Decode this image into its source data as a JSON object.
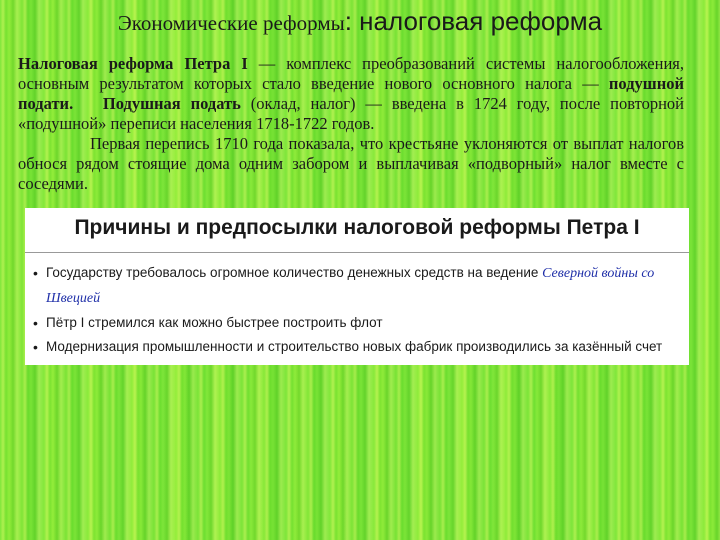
{
  "title": {
    "part1": "Экономические реформы",
    "part2": ": налоговая реформа"
  },
  "paragraph1": {
    "bold_start": "Налоговая реформа Петра I",
    "text1": " — комплекс преобразований системы налогообложения, основным результатом которых стало введение нового основного налога — ",
    "bold_mid": "подушной подати.",
    "gap": "   ",
    "bold_mid2": "Подушная подать",
    "text2": " (оклад, налог) — введена в 1724 году, после повторной «подушной» переписи населения 1718-1722 годов."
  },
  "paragraph2": "Первая перепись 1710 года показала, что крестьяне уклоняются от выплат налогов обнося рядом стоящие дома одним забором и выплачивая «подворный» налог вместе с соседями.",
  "card": {
    "title": "Причины и предпосылки налоговой реформы Петра I",
    "items": [
      {
        "text": "Государству требовалось огромное количество денежных средств на ведение ",
        "link": "Северной войны со Швецией"
      },
      {
        "text": "Пётр I стремился как можно быстрее построить флот"
      },
      {
        "text": "Модернизация промышленности и строительство новых фабрик производились за казённый счет"
      }
    ]
  },
  "colors": {
    "background": "#7ee63a",
    "link": "#1f2fa8",
    "card": "#ffffff"
  }
}
